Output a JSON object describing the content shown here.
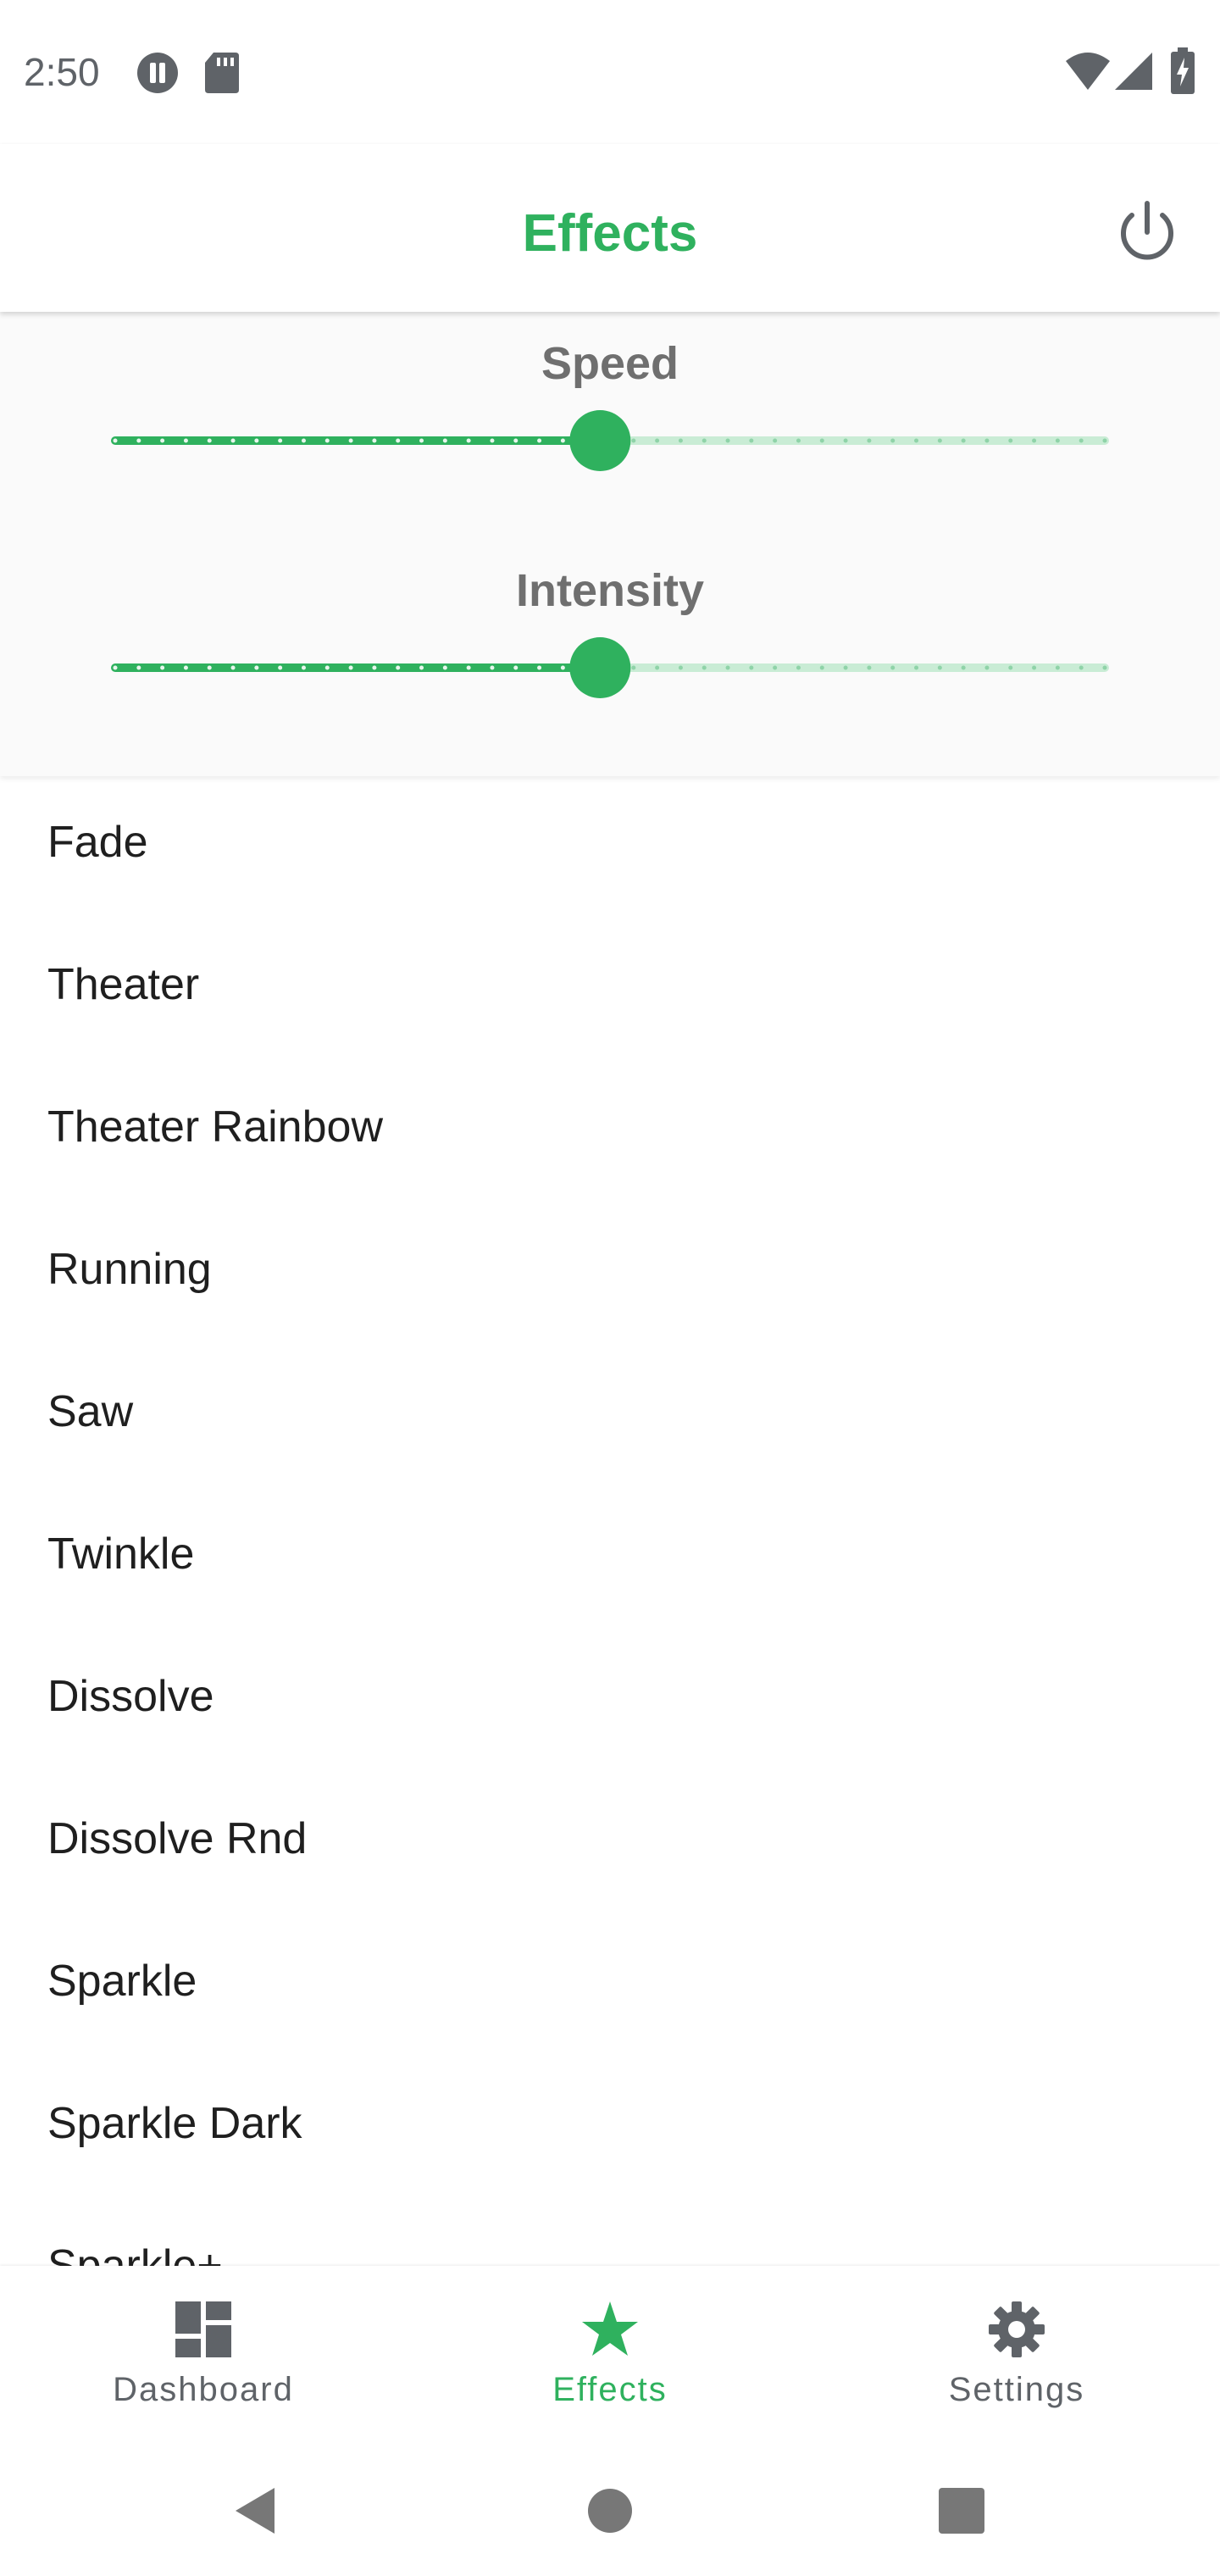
{
  "status_bar": {
    "time": "2:50",
    "left_icons": [
      "pause-circle-icon",
      "sd-card-icon"
    ],
    "right_icons": [
      "wifi-icon",
      "cell-signal-icon",
      "battery-charging-icon"
    ]
  },
  "app_bar": {
    "title": "Effects",
    "action_icon": "power-icon"
  },
  "controls": {
    "speed": {
      "label": "Speed",
      "value_fraction": 0.49
    },
    "intensity": {
      "label": "Intensity",
      "value_fraction": 0.49
    }
  },
  "effects": [
    {
      "label": "Fade"
    },
    {
      "label": "Theater"
    },
    {
      "label": "Theater Rainbow"
    },
    {
      "label": "Running"
    },
    {
      "label": "Saw"
    },
    {
      "label": "Twinkle"
    },
    {
      "label": "Dissolve"
    },
    {
      "label": "Dissolve Rnd"
    },
    {
      "label": "Sparkle"
    },
    {
      "label": "Sparkle Dark"
    },
    {
      "label": "Sparkle+"
    }
  ],
  "bottom_nav": {
    "items": [
      {
        "label": "Dashboard",
        "icon": "dashboard-icon",
        "active": false
      },
      {
        "label": "Effects",
        "icon": "star-icon",
        "active": true
      },
      {
        "label": "Settings",
        "icon": "gear-icon",
        "active": false
      }
    ]
  },
  "colors": {
    "accent": "#2fb15e",
    "accent_light": "#c9ecd5",
    "text_primary": "#1f1f1f",
    "text_secondary": "#5f6368"
  }
}
